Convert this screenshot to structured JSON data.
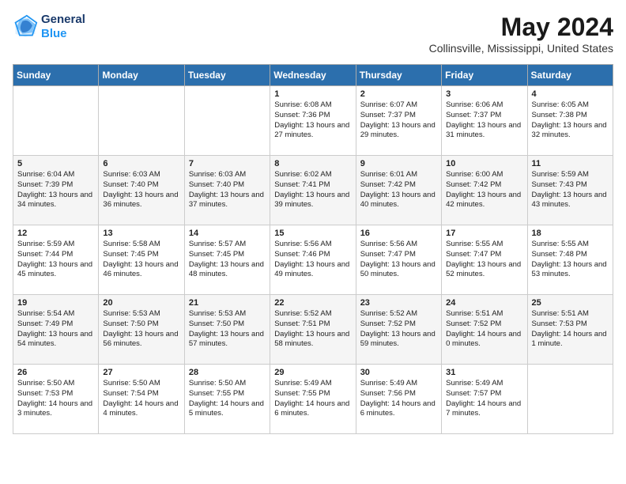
{
  "header": {
    "logo_line1": "General",
    "logo_line2": "Blue",
    "title": "May 2024",
    "subtitle": "Collinsville, Mississippi, United States"
  },
  "days_of_week": [
    "Sunday",
    "Monday",
    "Tuesday",
    "Wednesday",
    "Thursday",
    "Friday",
    "Saturday"
  ],
  "weeks": [
    [
      {
        "day": "",
        "info": ""
      },
      {
        "day": "",
        "info": ""
      },
      {
        "day": "",
        "info": ""
      },
      {
        "day": "1",
        "info": "Sunrise: 6:08 AM\nSunset: 7:36 PM\nDaylight: 13 hours\nand 27 minutes."
      },
      {
        "day": "2",
        "info": "Sunrise: 6:07 AM\nSunset: 7:37 PM\nDaylight: 13 hours\nand 29 minutes."
      },
      {
        "day": "3",
        "info": "Sunrise: 6:06 AM\nSunset: 7:37 PM\nDaylight: 13 hours\nand 31 minutes."
      },
      {
        "day": "4",
        "info": "Sunrise: 6:05 AM\nSunset: 7:38 PM\nDaylight: 13 hours\nand 32 minutes."
      }
    ],
    [
      {
        "day": "5",
        "info": "Sunrise: 6:04 AM\nSunset: 7:39 PM\nDaylight: 13 hours\nand 34 minutes."
      },
      {
        "day": "6",
        "info": "Sunrise: 6:03 AM\nSunset: 7:40 PM\nDaylight: 13 hours\nand 36 minutes."
      },
      {
        "day": "7",
        "info": "Sunrise: 6:03 AM\nSunset: 7:40 PM\nDaylight: 13 hours\nand 37 minutes."
      },
      {
        "day": "8",
        "info": "Sunrise: 6:02 AM\nSunset: 7:41 PM\nDaylight: 13 hours\nand 39 minutes."
      },
      {
        "day": "9",
        "info": "Sunrise: 6:01 AM\nSunset: 7:42 PM\nDaylight: 13 hours\nand 40 minutes."
      },
      {
        "day": "10",
        "info": "Sunrise: 6:00 AM\nSunset: 7:42 PM\nDaylight: 13 hours\nand 42 minutes."
      },
      {
        "day": "11",
        "info": "Sunrise: 5:59 AM\nSunset: 7:43 PM\nDaylight: 13 hours\nand 43 minutes."
      }
    ],
    [
      {
        "day": "12",
        "info": "Sunrise: 5:59 AM\nSunset: 7:44 PM\nDaylight: 13 hours\nand 45 minutes."
      },
      {
        "day": "13",
        "info": "Sunrise: 5:58 AM\nSunset: 7:45 PM\nDaylight: 13 hours\nand 46 minutes."
      },
      {
        "day": "14",
        "info": "Sunrise: 5:57 AM\nSunset: 7:45 PM\nDaylight: 13 hours\nand 48 minutes."
      },
      {
        "day": "15",
        "info": "Sunrise: 5:56 AM\nSunset: 7:46 PM\nDaylight: 13 hours\nand 49 minutes."
      },
      {
        "day": "16",
        "info": "Sunrise: 5:56 AM\nSunset: 7:47 PM\nDaylight: 13 hours\nand 50 minutes."
      },
      {
        "day": "17",
        "info": "Sunrise: 5:55 AM\nSunset: 7:47 PM\nDaylight: 13 hours\nand 52 minutes."
      },
      {
        "day": "18",
        "info": "Sunrise: 5:55 AM\nSunset: 7:48 PM\nDaylight: 13 hours\nand 53 minutes."
      }
    ],
    [
      {
        "day": "19",
        "info": "Sunrise: 5:54 AM\nSunset: 7:49 PM\nDaylight: 13 hours\nand 54 minutes."
      },
      {
        "day": "20",
        "info": "Sunrise: 5:53 AM\nSunset: 7:50 PM\nDaylight: 13 hours\nand 56 minutes."
      },
      {
        "day": "21",
        "info": "Sunrise: 5:53 AM\nSunset: 7:50 PM\nDaylight: 13 hours\nand 57 minutes."
      },
      {
        "day": "22",
        "info": "Sunrise: 5:52 AM\nSunset: 7:51 PM\nDaylight: 13 hours\nand 58 minutes."
      },
      {
        "day": "23",
        "info": "Sunrise: 5:52 AM\nSunset: 7:52 PM\nDaylight: 13 hours\nand 59 minutes."
      },
      {
        "day": "24",
        "info": "Sunrise: 5:51 AM\nSunset: 7:52 PM\nDaylight: 14 hours\nand 0 minutes."
      },
      {
        "day": "25",
        "info": "Sunrise: 5:51 AM\nSunset: 7:53 PM\nDaylight: 14 hours\nand 1 minute."
      }
    ],
    [
      {
        "day": "26",
        "info": "Sunrise: 5:50 AM\nSunset: 7:53 PM\nDaylight: 14 hours\nand 3 minutes."
      },
      {
        "day": "27",
        "info": "Sunrise: 5:50 AM\nSunset: 7:54 PM\nDaylight: 14 hours\nand 4 minutes."
      },
      {
        "day": "28",
        "info": "Sunrise: 5:50 AM\nSunset: 7:55 PM\nDaylight: 14 hours\nand 5 minutes."
      },
      {
        "day": "29",
        "info": "Sunrise: 5:49 AM\nSunset: 7:55 PM\nDaylight: 14 hours\nand 6 minutes."
      },
      {
        "day": "30",
        "info": "Sunrise: 5:49 AM\nSunset: 7:56 PM\nDaylight: 14 hours\nand 6 minutes."
      },
      {
        "day": "31",
        "info": "Sunrise: 5:49 AM\nSunset: 7:57 PM\nDaylight: 14 hours\nand 7 minutes."
      },
      {
        "day": "",
        "info": ""
      }
    ]
  ]
}
